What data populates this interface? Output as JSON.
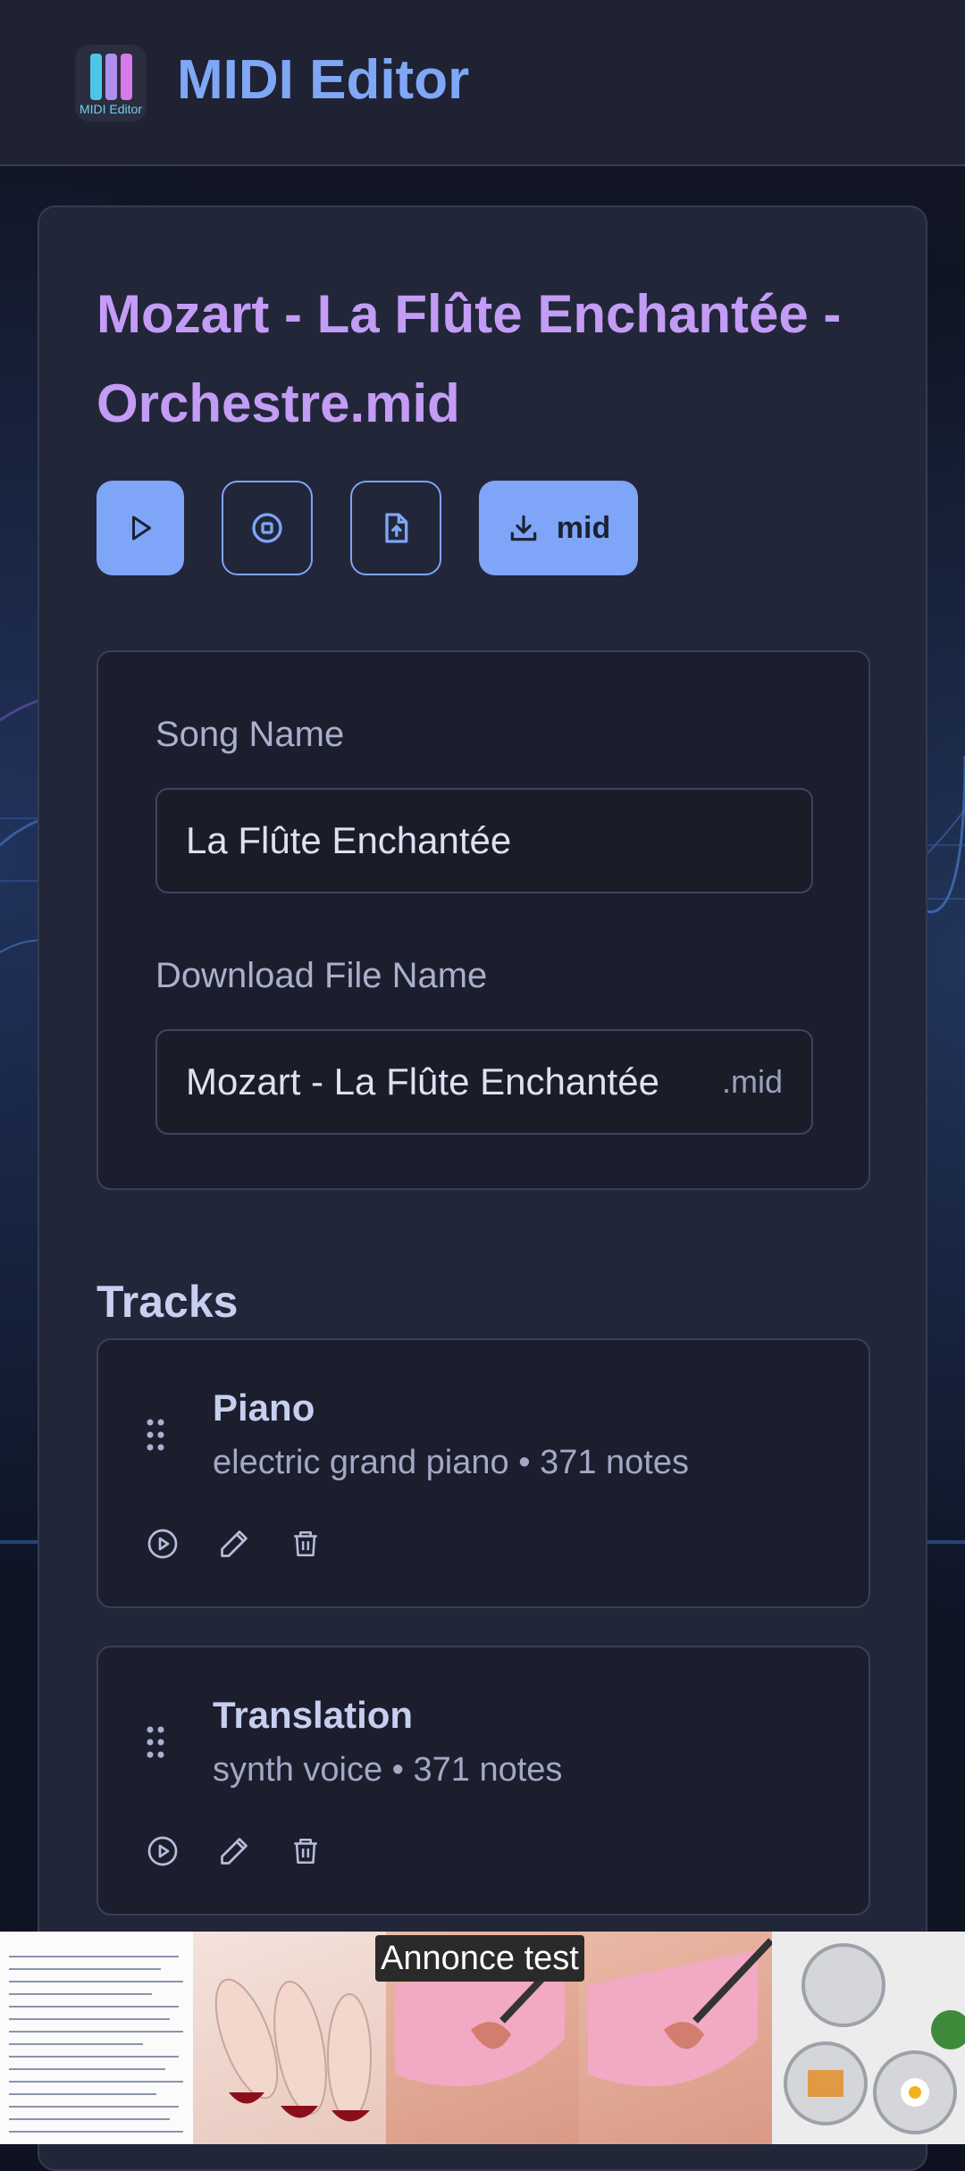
{
  "app": {
    "title": "MIDI Editor",
    "logo_text": "MIDI Editor"
  },
  "song": {
    "title": "Mozart - La Flûte Enchantée - Orchestre.mid",
    "download_label": "mid"
  },
  "form": {
    "song_name_label": "Song Name",
    "song_name_value": "La Flûte Enchantée",
    "file_name_label": "Download File Name",
    "file_name_value": "Mozart - La Flûte Enchantée",
    "file_suffix": ".mid"
  },
  "tracks": {
    "heading": "Tracks",
    "items": [
      {
        "name": "Piano",
        "meta": "electric grand piano • 371 notes"
      },
      {
        "name": "Translation",
        "meta": "synth voice • 371 notes"
      }
    ]
  },
  "ad": {
    "label": "Annonce test"
  },
  "colors": {
    "accent": "#7ea5f7",
    "title": "#c39cf5",
    "card": "#222639",
    "panel": "#1c1e2d"
  },
  "icons": [
    "play-icon",
    "stop-icon",
    "file-upload-icon",
    "download-icon",
    "grip-icon",
    "play-circle-icon",
    "edit-icon",
    "trash-icon"
  ]
}
